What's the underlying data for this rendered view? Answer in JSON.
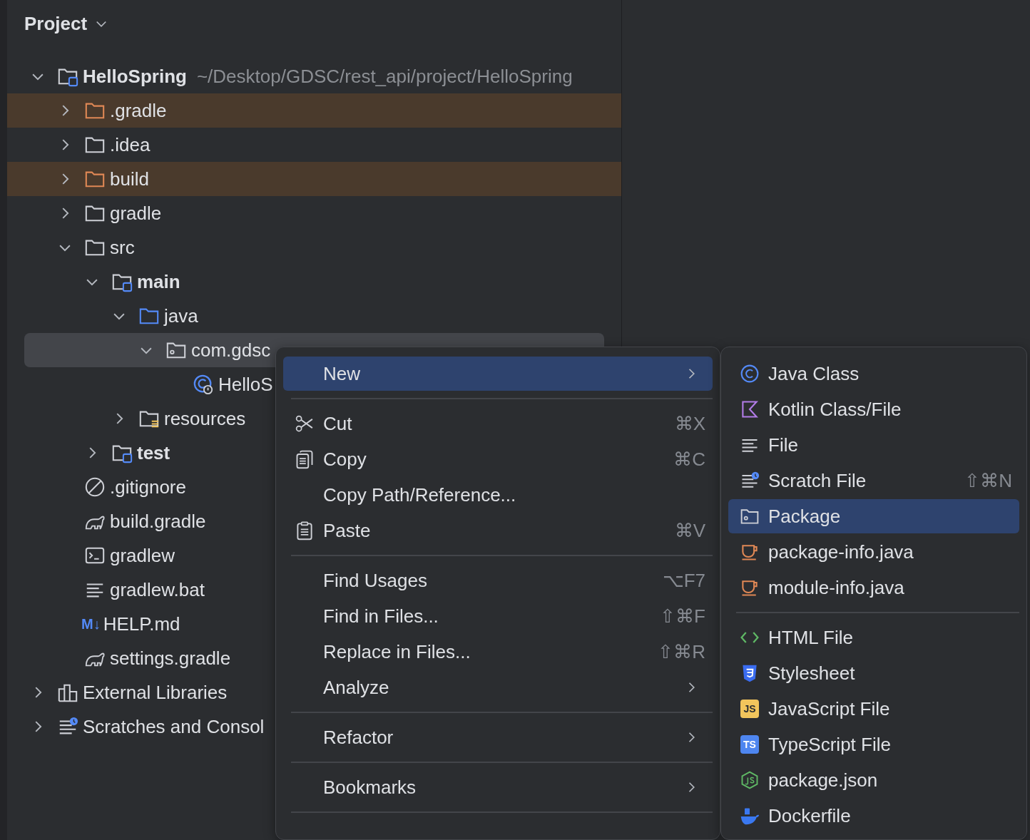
{
  "panel": {
    "title": "Project"
  },
  "tree": [
    {
      "name": "HelloSpring",
      "kind": "module",
      "path": "~/Desktop/GDSC/rest_api/project/HelloSpring",
      "expanded": true,
      "excluded": false,
      "selected": false,
      "children": [
        {
          "name": ".gradle",
          "kind": "folder",
          "expanded": false,
          "excluded": true,
          "selected": false
        },
        {
          "name": ".idea",
          "kind": "folder",
          "expanded": false,
          "excluded": false,
          "selected": false
        },
        {
          "name": "build",
          "kind": "folder",
          "expanded": false,
          "excluded": true,
          "selected": false
        },
        {
          "name": "gradle",
          "kind": "folder",
          "expanded": false,
          "excluded": false,
          "selected": false
        },
        {
          "name": "src",
          "kind": "folder",
          "expanded": true,
          "excluded": false,
          "selected": false,
          "children": [
            {
              "name": "main",
              "kind": "module",
              "expanded": true,
              "excluded": false,
              "selected": false,
              "children": [
                {
                  "name": "java",
                  "kind": "source",
                  "expanded": true,
                  "excluded": false,
                  "selected": false,
                  "children": [
                    {
                      "name": "com.gdsc",
                      "kind": "package",
                      "expanded": true,
                      "excluded": false,
                      "selected": true,
                      "children": [
                        {
                          "name": "HelloS",
                          "kind": "class",
                          "excluded": false,
                          "selected": false
                        }
                      ]
                    }
                  ]
                },
                {
                  "name": "resources",
                  "kind": "resources",
                  "expanded": false,
                  "excluded": false,
                  "selected": false
                }
              ]
            },
            {
              "name": "test",
              "kind": "module",
              "expanded": false,
              "excluded": false,
              "selected": false
            }
          ]
        },
        {
          "name": ".gitignore",
          "kind": "ignore",
          "excluded": false,
          "selected": false
        },
        {
          "name": "build.gradle",
          "kind": "gradle",
          "excluded": false,
          "selected": false
        },
        {
          "name": "gradlew",
          "kind": "terminal",
          "excluded": false,
          "selected": false
        },
        {
          "name": "gradlew.bat",
          "kind": "text",
          "excluded": false,
          "selected": false
        },
        {
          "name": "HELP.md",
          "kind": "markdown",
          "badge": "M↓",
          "excluded": false,
          "selected": false
        },
        {
          "name": "settings.gradle",
          "kind": "gradle",
          "excluded": false,
          "selected": false
        }
      ]
    },
    {
      "name": "External Libraries",
      "kind": "libraries",
      "expanded": false,
      "excluded": false,
      "selected": false
    },
    {
      "name": "Scratches and Consol",
      "kind": "scratches",
      "expanded": false,
      "excluded": false,
      "selected": false
    }
  ],
  "context_menu": [
    {
      "kind": "plain",
      "label": "New",
      "submenu": true,
      "selected": true
    },
    {
      "kind": "separator"
    },
    {
      "kind": "scissors",
      "label": "Cut",
      "shortcut": "⌘X",
      "submenu": false,
      "selected": false
    },
    {
      "kind": "copy",
      "label": "Copy",
      "shortcut": "⌘C",
      "submenu": false,
      "selected": false
    },
    {
      "kind": "plain",
      "label": "Copy Path/Reference...",
      "submenu": false,
      "selected": false
    },
    {
      "kind": "paste",
      "label": "Paste",
      "shortcut": "⌘V",
      "submenu": false,
      "selected": false
    },
    {
      "kind": "separator"
    },
    {
      "kind": "plain",
      "label": "Find Usages",
      "shortcut": "⌥F7",
      "submenu": false,
      "selected": false
    },
    {
      "kind": "plain",
      "label": "Find in Files...",
      "shortcut": "⇧⌘F",
      "submenu": false,
      "selected": false
    },
    {
      "kind": "plain",
      "label": "Replace in Files...",
      "shortcut": "⇧⌘R",
      "submenu": false,
      "selected": false
    },
    {
      "kind": "plain",
      "label": "Analyze",
      "submenu": true,
      "selected": false
    },
    {
      "kind": "separator"
    },
    {
      "kind": "plain",
      "label": "Refactor",
      "submenu": true,
      "selected": false
    },
    {
      "kind": "separator"
    },
    {
      "kind": "plain",
      "label": "Bookmarks",
      "submenu": true,
      "selected": false
    },
    {
      "kind": "separator"
    }
  ],
  "new_submenu": [
    {
      "kind": "java-class",
      "label": "Java Class",
      "selected": false
    },
    {
      "kind": "kotlin",
      "label": "Kotlin Class/File",
      "selected": false
    },
    {
      "kind": "text",
      "label": "File",
      "selected": false
    },
    {
      "kind": "scratches",
      "label": "Scratch File",
      "shortcut": "⇧⌘N",
      "selected": false
    },
    {
      "kind": "package",
      "label": "Package",
      "selected": true
    },
    {
      "kind": "cup",
      "label": "package-info.java",
      "selected": false
    },
    {
      "kind": "cup",
      "label": "module-info.java",
      "selected": false
    },
    {
      "kind": "separator"
    },
    {
      "kind": "html",
      "label": "HTML File",
      "selected": false
    },
    {
      "kind": "css",
      "label": "Stylesheet",
      "selected": false
    },
    {
      "kind": "js",
      "label": "JavaScript File",
      "badge": "JS",
      "selected": false
    },
    {
      "kind": "ts",
      "label": "TypeScript File",
      "badge": "TS",
      "selected": false
    },
    {
      "kind": "node",
      "label": "package.json",
      "selected": false
    },
    {
      "kind": "docker",
      "label": "Dockerfile",
      "selected": false
    }
  ]
}
